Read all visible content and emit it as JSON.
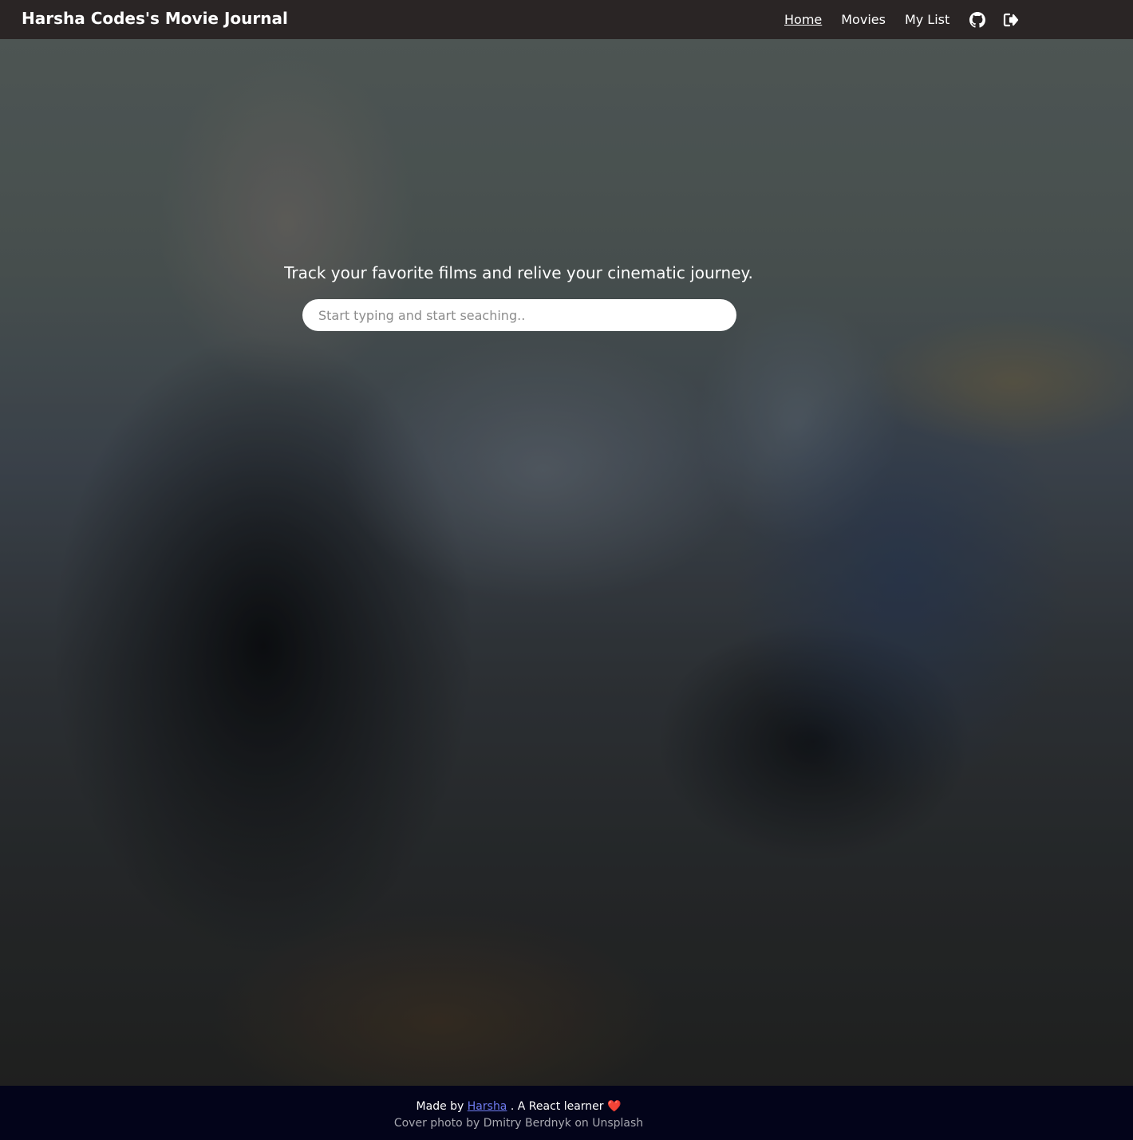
{
  "navbar": {
    "brand": "Harsha Codes's Movie Journal",
    "links": [
      {
        "label": "Home",
        "active": true
      },
      {
        "label": "Movies",
        "active": false
      },
      {
        "label": "My List",
        "active": false
      }
    ],
    "icons": [
      "github-icon",
      "logout-icon"
    ]
  },
  "hero": {
    "tagline": "Track your favorite films and relive your cinematic journey.",
    "search": {
      "placeholder": "Start typing and start seaching..",
      "value": ""
    }
  },
  "footer": {
    "made_by_prefix": "Made by",
    "author_link": "Harsha",
    "made_by_suffix": ". A React learner",
    "heart": "❤️",
    "credit": "Cover photo by Dmitry Berdnyk on Unsplash"
  },
  "colors": {
    "navbar_bg": "#2a2525",
    "footer_bg": "#03041a",
    "link_accent": "#6f7cf0"
  }
}
